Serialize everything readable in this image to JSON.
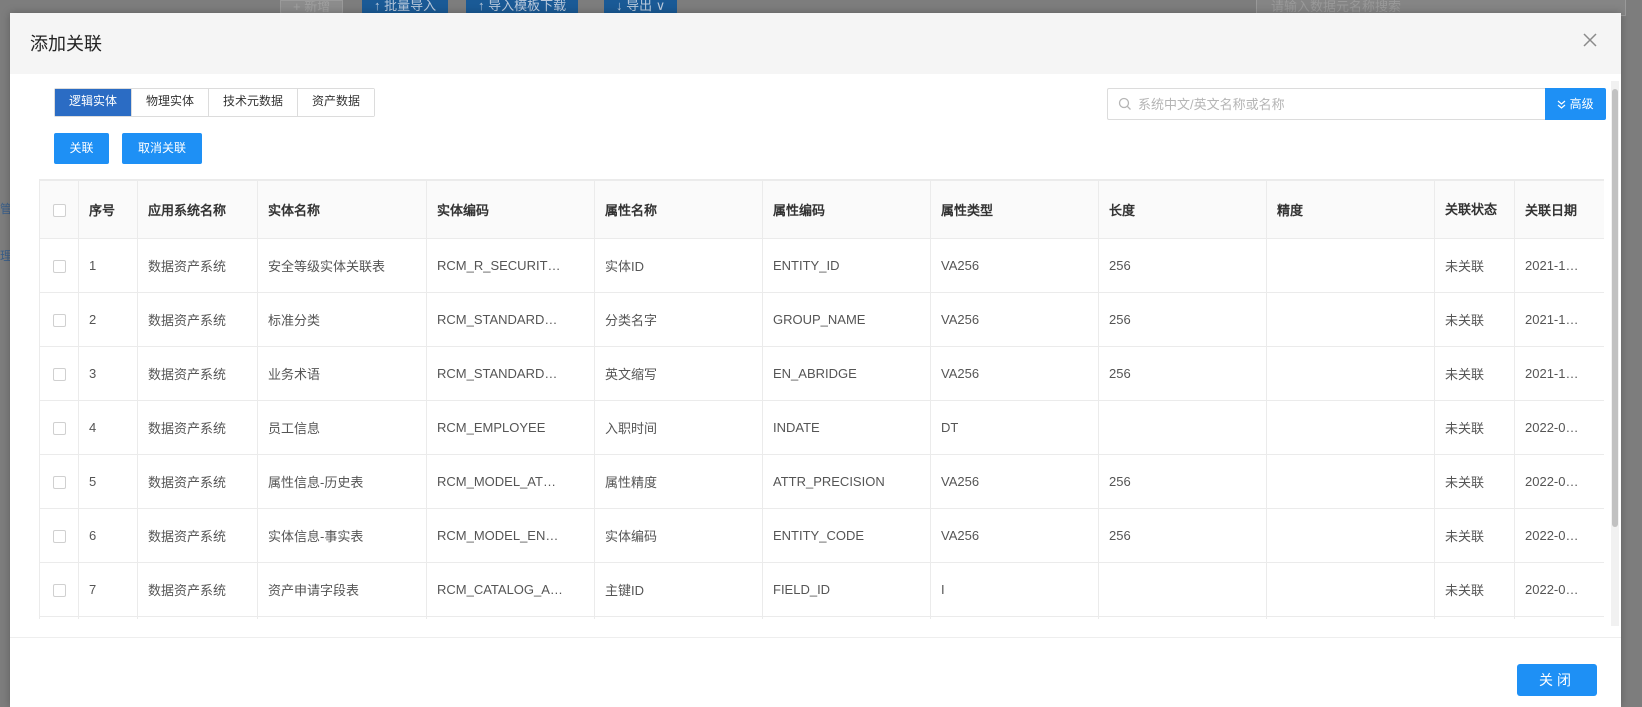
{
  "background": {
    "buttons": [
      "+ 新增",
      "↑ 批量导入",
      "↑ 导入模板下载",
      "↓ 导出 ∨"
    ],
    "search_placeholder": "请输入数据元名称搜索",
    "edge_texts": [
      "管",
      "理"
    ]
  },
  "dialog": {
    "title": "添加关联",
    "close_icon": "close-icon"
  },
  "tabs": [
    {
      "label": "逻辑实体",
      "active": true
    },
    {
      "label": "物理实体",
      "active": false
    },
    {
      "label": "技术元数据",
      "active": false
    },
    {
      "label": "资产数据",
      "active": false
    }
  ],
  "search": {
    "placeholder": "系统中文/英文名称或名称",
    "icon": "search-icon",
    "advanced_label": "高级",
    "advanced_icon": "double-chevron-down-icon"
  },
  "actions": {
    "associate_label": "关联",
    "disassociate_label": "取消关联"
  },
  "table": {
    "columns": [
      "序号",
      "应用系统名称",
      "实体名称",
      "实体编码",
      "属性名称",
      "属性编码",
      "属性类型",
      "长度",
      "精度",
      "关联状态",
      "关联日期"
    ],
    "rows": [
      [
        "1",
        "数据资产系统",
        "安全等级实体关联表",
        "RCM_R_SECURIT…",
        "实体ID",
        "ENTITY_ID",
        "VA256",
        "256",
        "",
        "未关联",
        "2021-1…"
      ],
      [
        "2",
        "数据资产系统",
        "标准分类",
        "RCM_STANDARD…",
        "分类名字",
        "GROUP_NAME",
        "VA256",
        "256",
        "",
        "未关联",
        "2021-1…"
      ],
      [
        "3",
        "数据资产系统",
        "业务术语",
        "RCM_STANDARD…",
        "英文缩写",
        "EN_ABRIDGE",
        "VA256",
        "256",
        "",
        "未关联",
        "2021-1…"
      ],
      [
        "4",
        "数据资产系统",
        "员工信息",
        "RCM_EMPLOYEE",
        "入职时间",
        "INDATE",
        "DT",
        "",
        "",
        "未关联",
        "2022-0…"
      ],
      [
        "5",
        "数据资产系统",
        "属性信息-历史表",
        "RCM_MODEL_AT…",
        "属性精度",
        "ATTR_PRECISION",
        "VA256",
        "256",
        "",
        "未关联",
        "2022-0…"
      ],
      [
        "6",
        "数据资产系统",
        "实体信息-事实表",
        "RCM_MODEL_EN…",
        "实体编码",
        "ENTITY_CODE",
        "VA256",
        "256",
        "",
        "未关联",
        "2022-0…"
      ],
      [
        "7",
        "数据资产系统",
        "资产申请字段表",
        "RCM_CATALOG_A…",
        "主键ID",
        "FIELD_ID",
        "I",
        "",
        "",
        "未关联",
        "2022-0…"
      ],
      [
        "",
        "",
        "",
        "",
        "",
        "",
        "",
        "",
        "",
        "",
        ""
      ]
    ]
  },
  "footer": {
    "close_label": "关闭"
  },
  "colors": {
    "primary": "#1e90f5",
    "tab_active": "#2b6cc4",
    "header_bg": "#f5f5f5"
  }
}
